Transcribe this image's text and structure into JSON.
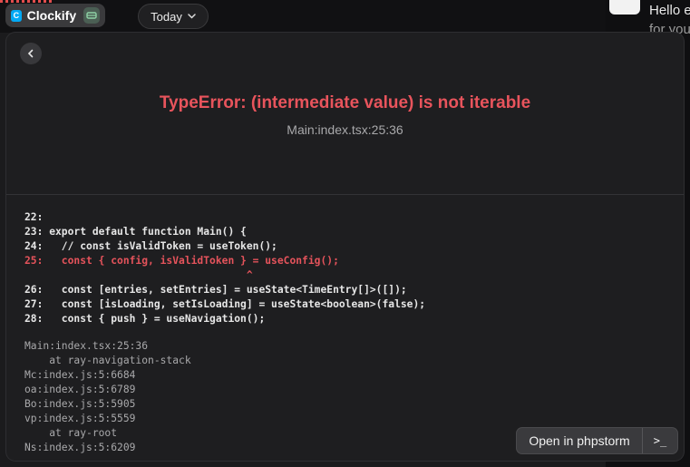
{
  "menubar": {
    "app_name": "Clockify",
    "app_logo_letter": "C",
    "date_filter": "Today"
  },
  "background": {
    "greeting_line1": "Hello e",
    "greeting_line2": "for you"
  },
  "error": {
    "title": "TypeError: (intermediate value) is not iterable",
    "location": "Main:index.tsx:25:36"
  },
  "code_lines": [
    {
      "text": "22:",
      "error": false
    },
    {
      "text": "23: export default function Main() {",
      "error": false
    },
    {
      "text": "24:   // const isValidToken = useToken();",
      "error": false
    },
    {
      "text": "25:   const { config, isValidToken } = useConfig();",
      "error": true
    },
    {
      "text": "                                    ^",
      "error": true
    },
    {
      "text": "26:   const [entries, setEntries] = useState<TimeEntry[]>([]);",
      "error": false
    },
    {
      "text": "27:   const [isLoading, setIsLoading] = useState<boolean>(false);",
      "error": false
    },
    {
      "text": "28:   const { push } = useNavigation();",
      "error": false
    }
  ],
  "stack_trace": [
    "Main:index.tsx:25:36",
    "    at ray-navigation-stack",
    "Mc:index.js:5:6684",
    "oa:index.js:5:6789",
    "Bo:index.js:5:5905",
    "vp:index.js:5:5559",
    "    at ray-root",
    "Ns:index.js:5:6209"
  ],
  "actions": {
    "primary_label": "Open in phpstorm",
    "secondary_label": ">_"
  },
  "colors": {
    "error_red": "#e8545c",
    "window_bg": "#1e1e20",
    "accent_blue": "#03a9f4"
  }
}
